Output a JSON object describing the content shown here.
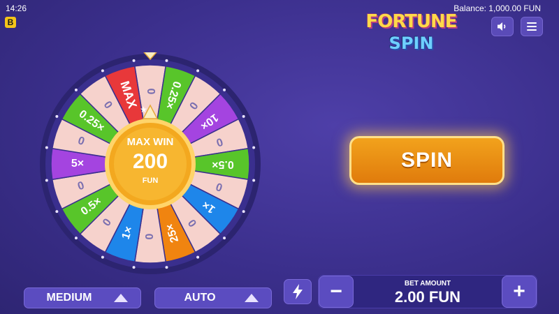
{
  "status": {
    "time": "14:26",
    "badge": "B"
  },
  "balance": "Balance:  1,000.00 FUN",
  "logo": {
    "line1": "FORTUNE",
    "line2": "SPIN"
  },
  "icons": {
    "sound": "speaker-icon",
    "menu": "hamburger-menu-icon",
    "turbo": "lightning-bolt-icon"
  },
  "wheel": {
    "segments": [
      {
        "label": "0",
        "color": "#f6d2cc"
      },
      {
        "label": "0.25×",
        "color": "#58c52a"
      },
      {
        "label": "0",
        "color": "#f6d2cc"
      },
      {
        "label": "10×",
        "color": "#a444e0"
      },
      {
        "label": "0",
        "color": "#f6d2cc"
      },
      {
        "label": "0.5×",
        "color": "#58c52a"
      },
      {
        "label": "0",
        "color": "#f6d2cc"
      },
      {
        "label": "1×",
        "color": "#1e86ea"
      },
      {
        "label": "0",
        "color": "#f6d2cc"
      },
      {
        "label": "25×",
        "color": "#f08410"
      },
      {
        "label": "0",
        "color": "#f6d2cc"
      },
      {
        "label": "1×",
        "color": "#1e86ea"
      },
      {
        "label": "0",
        "color": "#f6d2cc"
      },
      {
        "label": "0.5×",
        "color": "#58c52a"
      },
      {
        "label": "0",
        "color": "#f6d2cc"
      },
      {
        "label": "5×",
        "color": "#a444e0"
      },
      {
        "label": "0",
        "color": "#f6d2cc"
      },
      {
        "label": "0.25×",
        "color": "#58c52a"
      },
      {
        "label": "0",
        "color": "#f6d2cc"
      },
      {
        "label": "MAX",
        "color": "#e8383a"
      }
    ],
    "center": {
      "title": "MAX WIN",
      "amount": "200",
      "currency": "FUN"
    }
  },
  "spin_label": "SPIN",
  "risk": {
    "label": "MEDIUM"
  },
  "auto": {
    "label": "AUTO"
  },
  "bet": {
    "label": "BET AMOUNT",
    "value": "2.00 FUN",
    "minus": "−",
    "plus": "+"
  }
}
